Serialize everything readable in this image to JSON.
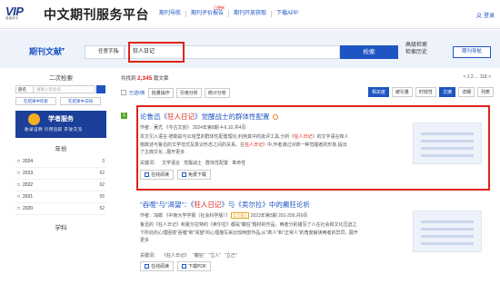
{
  "header": {
    "logo_mark": "VIP",
    "logo_sub": "维普资讯",
    "site_title": "中文期刊服务平台",
    "nav": [
      "期刊导航",
      "期刊评价报告",
      "期刊开放获取",
      "下载APP"
    ],
    "nav_hot_badge": "已更新",
    "login": "登录"
  },
  "search": {
    "brand": "期刊文献",
    "field": "任意字段",
    "query": "狂人日记",
    "button": "检索",
    "advanced": "高级检索",
    "history": "检索历史",
    "guide": "期刊导航"
  },
  "sidebar": {
    "secondary_title": "二次检索",
    "field": "题名",
    "keyword_placeholder": "请输入检索词",
    "btn_in_results": "在结果中检索",
    "btn_exclude": "在结果中去除",
    "banner_title": "学者服务",
    "banner_sub": "收录证明  引用追踪  开放交流",
    "year_title": "年份",
    "years": [
      {
        "year": "2024",
        "count": "3"
      },
      {
        "year": "2023",
        "count": "62"
      },
      {
        "year": "2022",
        "count": "62"
      },
      {
        "year": "2021",
        "count": "55"
      },
      {
        "year": "2020",
        "count": "52"
      }
    ],
    "subject_title": "学科"
  },
  "results": {
    "count_prefix": "共找到",
    "count": "2,345",
    "count_suffix": "篇文章",
    "pager": "< 1 2 ... 118 >",
    "selected": "已选0条",
    "tools": [
      "批量操作",
      "引用分析",
      "统计分析"
    ],
    "sort": [
      "相关度",
      "被引量",
      "时效性"
    ],
    "view": [
      "文摘",
      "详细",
      "列表"
    ]
  },
  "items": [
    {
      "index": "1",
      "title_before": "论鲁迅《",
      "title_hl": "狂人日记",
      "title_after": "》觉醒战士的群体性配置",
      "meta_author_label": "作者：",
      "meta_author": "吴亢",
      "meta_source": "《今古文创》",
      "meta_issue": "2024年第8期 4-6,10,共4页",
      "abstract_1": "本文引入语言-德勒兹与瓜塔里的群体性配置理论,利用其中的批评工具,分析《",
      "abstract_hl": "狂人日记",
      "abstract_2": "》的文字语言和人物数述与鲁迅的文学范式及意识形态之间的关系。在",
      "abstract_3": "》中,作者通过对疯一种觉醒者的形象,提出了古典文化...展开更多",
      "keywords_label": "关键词：",
      "keywords": [
        "文学语言",
        "觉醒战士",
        "群体性配置",
        "革命性"
      ],
      "act_read": "在线阅读",
      "act_download": "免费下载"
    },
    {
      "index": "",
      "title_before": "\"吞噬\"与\"渴望\"：《",
      "title_hl": "狂人日记",
      "title_after": "》与《卖尔拉》中的癫狂论析",
      "meta_author_label": "作者：",
      "meta_author": "冯姣",
      "meta_source": "《中南大学学报（社会科学版）》",
      "meta_tag": "北大核心",
      "meta_issue": "2023年第5期 201-209,共9页",
      "abstract_1": "鲁迅的《狂人日记》和夏尔拉特的《卖尔拉》都是\"癫狂\"题材的作品。两者分别描写了人在社会和文化压迫之下所处的心理困境",
      "abstract_2": "\"吞噬\"和\"渴望\"的心理描写来比较两部作品,从\"疯人\"和\"正常人\"的角度解读两者的异同...展开更多",
      "keywords_label": "关键词：",
      "keywords": [
        "《狂人日记》",
        "\"癫狂\"",
        "\"立人\"",
        "\"立己\""
      ],
      "act_read": "在线阅读",
      "act_download": "下载PDF"
    }
  ]
}
